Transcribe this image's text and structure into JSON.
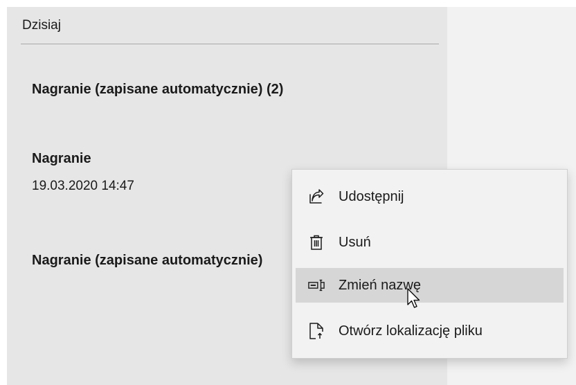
{
  "section": {
    "header": "Dzisiaj"
  },
  "recordings": [
    {
      "title": "Nagranie (zapisane automatycznie) (2)"
    },
    {
      "title": "Nagranie",
      "date": "19.03.2020 14:47"
    },
    {
      "title": "Nagranie (zapisane automatycznie)"
    }
  ],
  "context_menu": {
    "items": [
      {
        "label": "Udostępnij",
        "icon": "share-icon"
      },
      {
        "label": "Usuń",
        "icon": "trash-icon"
      },
      {
        "label": "Zmień nazwę",
        "icon": "rename-icon",
        "hovered": true
      },
      {
        "label": "Otwórz lokalizację pliku",
        "icon": "open-file-location-icon"
      }
    ]
  },
  "colors": {
    "list_background": "#e6e6e6",
    "menu_background": "#f2f2f2",
    "menu_hover": "#d6d6d6",
    "text": "#1a1a1a"
  }
}
